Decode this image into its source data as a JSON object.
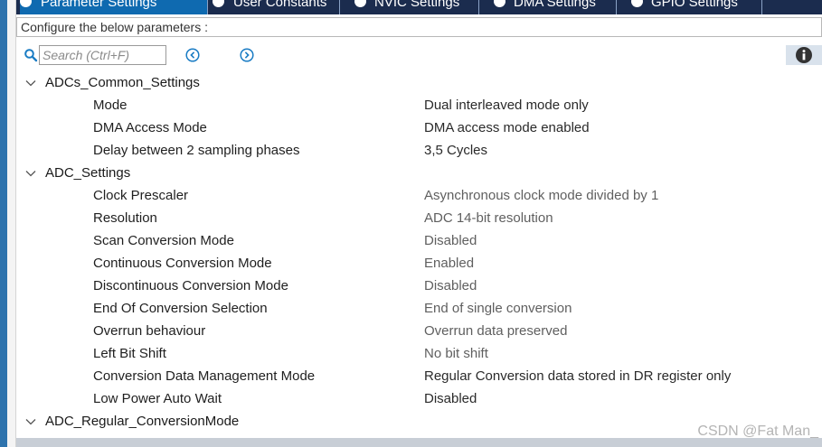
{
  "tabs": [
    {
      "label": "Parameter Settings",
      "active": true
    },
    {
      "label": "User Constants",
      "active": false
    },
    {
      "label": "NVIC Settings",
      "active": false
    },
    {
      "label": "DMA Settings",
      "active": false
    },
    {
      "label": "GPIO Settings",
      "active": false
    }
  ],
  "configure_text": "Configure the below parameters :",
  "search": {
    "placeholder": "Search (Ctrl+F)",
    "value": ""
  },
  "groups": [
    {
      "label": "ADCs_Common_Settings",
      "expanded": true,
      "params": [
        {
          "name": "Mode",
          "value": "Dual interleaved mode only"
        },
        {
          "name": "DMA Access Mode",
          "value": "DMA access mode enabled"
        },
        {
          "name": "Delay between 2 sampling phases",
          "value": "3,5 Cycles"
        }
      ]
    },
    {
      "label": "ADC_Settings",
      "expanded": true,
      "params": [
        {
          "name": "Clock Prescaler",
          "value": "Asynchronous clock mode divided by 1"
        },
        {
          "name": "Resolution",
          "value": "ADC 14-bit resolution"
        },
        {
          "name": "Scan Conversion Mode",
          "value": "Disabled"
        },
        {
          "name": "Continuous Conversion Mode",
          "value": "Enabled"
        },
        {
          "name": "Discontinuous Conversion Mode",
          "value": "Disabled"
        },
        {
          "name": "End Of Conversion Selection",
          "value": "End of single conversion"
        },
        {
          "name": "Overrun behaviour",
          "value": "Overrun data preserved"
        },
        {
          "name": "Left Bit Shift",
          "value": "No bit shift"
        },
        {
          "name": "Conversion Data Management Mode",
          "value": "Regular Conversion data stored in DR register only"
        },
        {
          "name": "Low Power Auto Wait",
          "value": "Disabled"
        }
      ]
    },
    {
      "label": "ADC_Regular_ConversionMode",
      "expanded": true,
      "params": []
    }
  ],
  "watermark": "CSDN @Fat Man_",
  "colors": {
    "tab_bar": "#1b2c4e",
    "tab_active": "#0f6ab0",
    "accent_icons": "#1a7cc4",
    "info_panel": "#d9e2ec"
  },
  "icons": {
    "search": "search-icon",
    "prev": "circle-chevron-left-icon",
    "next": "circle-chevron-right-icon",
    "info": "info-icon",
    "tab_check": "check-circle-icon",
    "group_toggle": "chevron-down-icon"
  }
}
